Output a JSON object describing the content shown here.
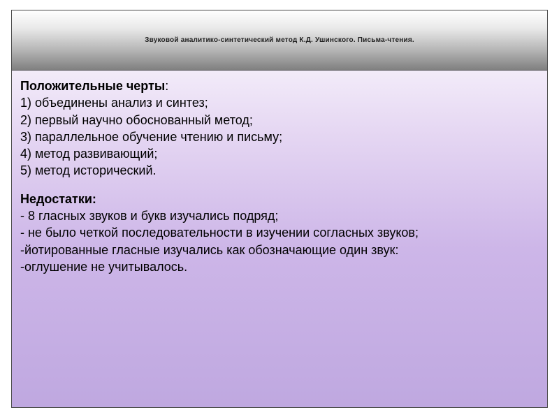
{
  "header": {
    "title": "Звуковой аналитико-синтетический метод  К.Д. Ушинского.  Письма-чтения."
  },
  "positives": {
    "heading": "Положительные черты",
    "colon": ":",
    "items": [
      "1) объединены анализ и синтез;",
      "2) первый научно обоснованный метод;",
      "3) параллельное обучение чтению и письму;",
      "4) метод развивающий;",
      "5) метод исторический."
    ]
  },
  "negatives": {
    "heading": "Недостатки:",
    "items": [
      "- 8 гласных звуков и букв изучались подряд;",
      "-  не было четкой последовательности в изучении согласных звуков;",
      "-йотированные гласные изучались как обозначающие один звук:",
      "-оглушение не учитывалось."
    ]
  }
}
